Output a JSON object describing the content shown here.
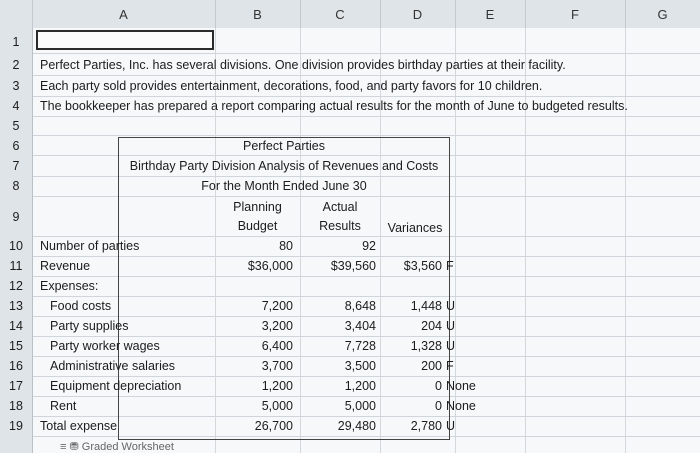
{
  "columns": [
    "A",
    "B",
    "C",
    "D",
    "E",
    "F",
    "G"
  ],
  "rows": [
    "1",
    "2",
    "3",
    "4",
    "5",
    "6",
    "7",
    "8",
    "9",
    "10",
    "11",
    "12",
    "13",
    "14",
    "15",
    "16",
    "17",
    "18",
    "19"
  ],
  "intro": [
    "Perfect Parties, Inc. has several divisions. One division provides birthday parties at their facility.",
    "Each party sold provides entertainment, decorations, food, and party favors for 10 children.",
    "The bookkeeper has prepared a report comparing actual results for the month of June to budgeted results."
  ],
  "report": {
    "title": "Perfect Parties",
    "subtitle": "Birthday Party Division Analysis of Revenues and Costs",
    "period": "For the Month Ended June 30",
    "col_planning_1": "Planning",
    "col_planning_2": "Budget",
    "col_actual_1": "Actual",
    "col_actual_2": "Results",
    "col_variances": "Variances"
  },
  "lines": [
    {
      "label": "Number of parties",
      "budget": "80",
      "actual": "92",
      "variance": "",
      "flag": ""
    },
    {
      "label": "Revenue",
      "budget": "$36,000",
      "actual": "$39,560",
      "variance": "$3,560",
      "flag": "F"
    },
    {
      "label": "Expenses:",
      "budget": "",
      "actual": "",
      "variance": "",
      "flag": ""
    },
    {
      "label": "Food costs",
      "budget": "7,200",
      "actual": "8,648",
      "variance": "1,448",
      "flag": "U"
    },
    {
      "label": "Party supplies",
      "budget": "3,200",
      "actual": "3,404",
      "variance": "204",
      "flag": "U"
    },
    {
      "label": "Party worker wages",
      "budget": "6,400",
      "actual": "7,728",
      "variance": "1,328",
      "flag": "U"
    },
    {
      "label": "Administrative salaries",
      "budget": "3,700",
      "actual": "3,500",
      "variance": "200",
      "flag": "F"
    },
    {
      "label": "Equipment depreciation",
      "budget": "1,200",
      "actual": "1,200",
      "variance": "0",
      "flag": "None"
    },
    {
      "label": "Rent",
      "budget": "5,000",
      "actual": "5,000",
      "variance": "0",
      "flag": "None"
    },
    {
      "label": "Total expense",
      "budget": "26,700",
      "actual": "29,480",
      "variance": "2,780",
      "flag": "U"
    }
  ],
  "footer": "Graded Worksheet"
}
